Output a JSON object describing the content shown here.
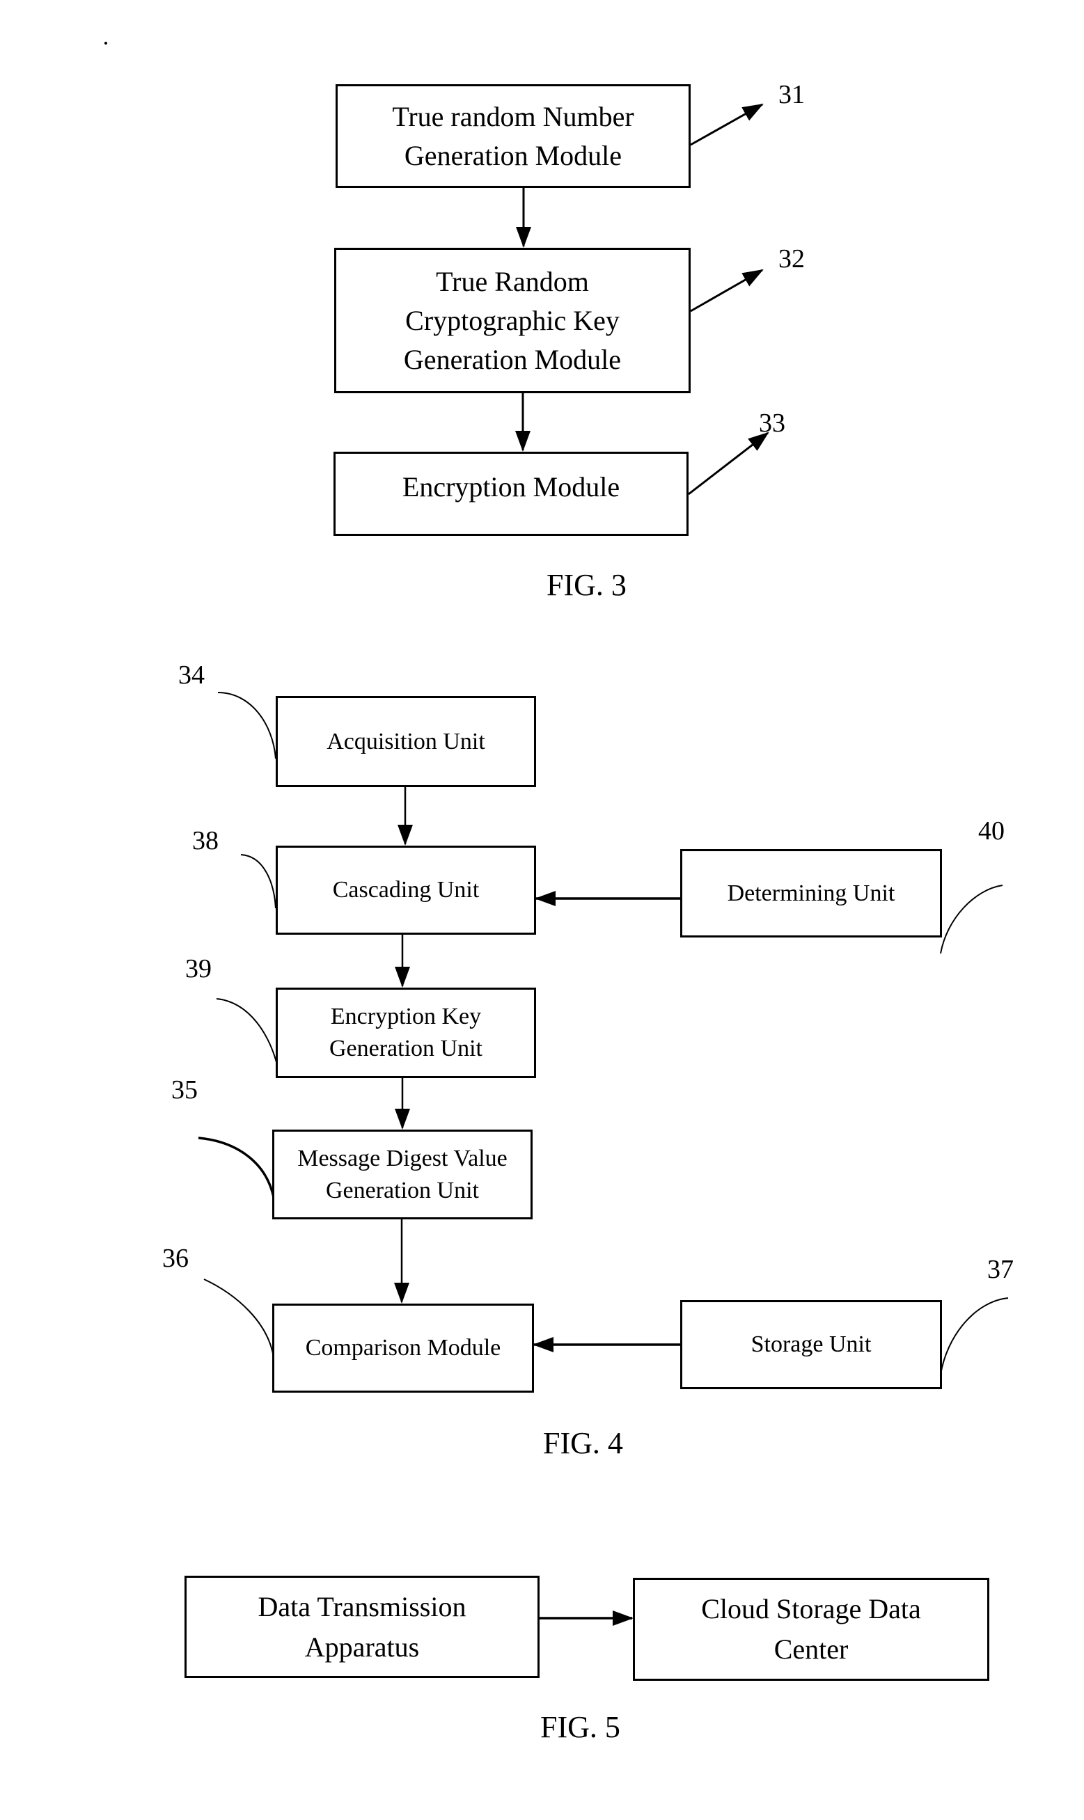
{
  "fig3": {
    "caption": "FIG. 3",
    "modules": [
      {
        "ref": "31",
        "label": "True random Number\nGeneration Module"
      },
      {
        "ref": "32",
        "label": "True Random\nCryptographic Key\nGeneration Module"
      },
      {
        "ref": "33",
        "label": "Encryption Module"
      }
    ],
    "flow": [
      {
        "from": "31",
        "to": "32"
      },
      {
        "from": "32",
        "to": "33"
      }
    ]
  },
  "fig4": {
    "caption": "FIG. 4",
    "units": [
      {
        "ref": "34",
        "label": "Acquisition Unit"
      },
      {
        "ref": "38",
        "label": "Cascading Unit"
      },
      {
        "ref": "40",
        "label": "Determining Unit"
      },
      {
        "ref": "39",
        "label": "Encryption Key\nGeneration Unit"
      },
      {
        "ref": "35",
        "label": "Message Digest Value\nGeneration Unit"
      },
      {
        "ref": "36",
        "label": "Comparison Module"
      },
      {
        "ref": "37",
        "label": "Storage Unit"
      }
    ],
    "flow": [
      {
        "from": "34",
        "to": "38"
      },
      {
        "from": "40",
        "to": "38"
      },
      {
        "from": "38",
        "to": "39"
      },
      {
        "from": "39",
        "to": "35"
      },
      {
        "from": "35",
        "to": "36"
      },
      {
        "from": "37",
        "to": "36"
      }
    ]
  },
  "fig5": {
    "caption": "FIG. 5",
    "blocks": [
      {
        "label": "Data Transmission\nApparatus"
      },
      {
        "label": "Cloud Storage Data\nCenter"
      }
    ],
    "flow": [
      {
        "from": "Data Transmission Apparatus",
        "to": "Cloud Storage Data Center"
      }
    ]
  }
}
